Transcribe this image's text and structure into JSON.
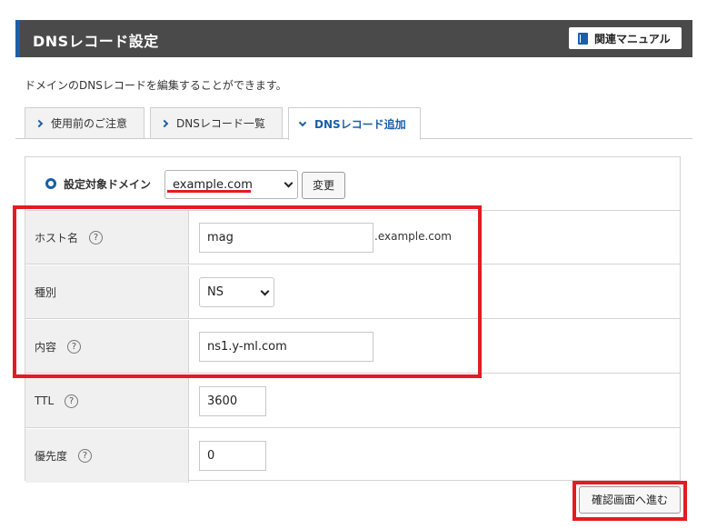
{
  "header": {
    "title": "DNSレコード設定",
    "manual_label": "関連マニュアル"
  },
  "description": "ドメインのDNSレコードを編集することができます。",
  "tabs": [
    {
      "label": "使用前のご注意",
      "active": false
    },
    {
      "label": "DNSレコード一覧",
      "active": false
    },
    {
      "label": "DNSレコード追加",
      "active": true
    }
  ],
  "domain": {
    "label": "設定対象ドメイン",
    "selected": "example.com",
    "change_label": "変更"
  },
  "form": {
    "host": {
      "label": "ホスト名",
      "value": "mag",
      "suffix": ".example.com"
    },
    "type": {
      "label": "種別",
      "value": "NS"
    },
    "content": {
      "label": "内容",
      "value": "ns1.y-ml.com"
    },
    "ttl": {
      "label": "TTL",
      "value": "3600"
    },
    "priority": {
      "label": "優先度",
      "value": "0"
    }
  },
  "help_glyph": "?",
  "confirm_label": "確認画面へ進む",
  "colors": {
    "accent": "#1a5fa8",
    "highlight": "#e31b23",
    "header_bg": "#4a4a4a"
  }
}
